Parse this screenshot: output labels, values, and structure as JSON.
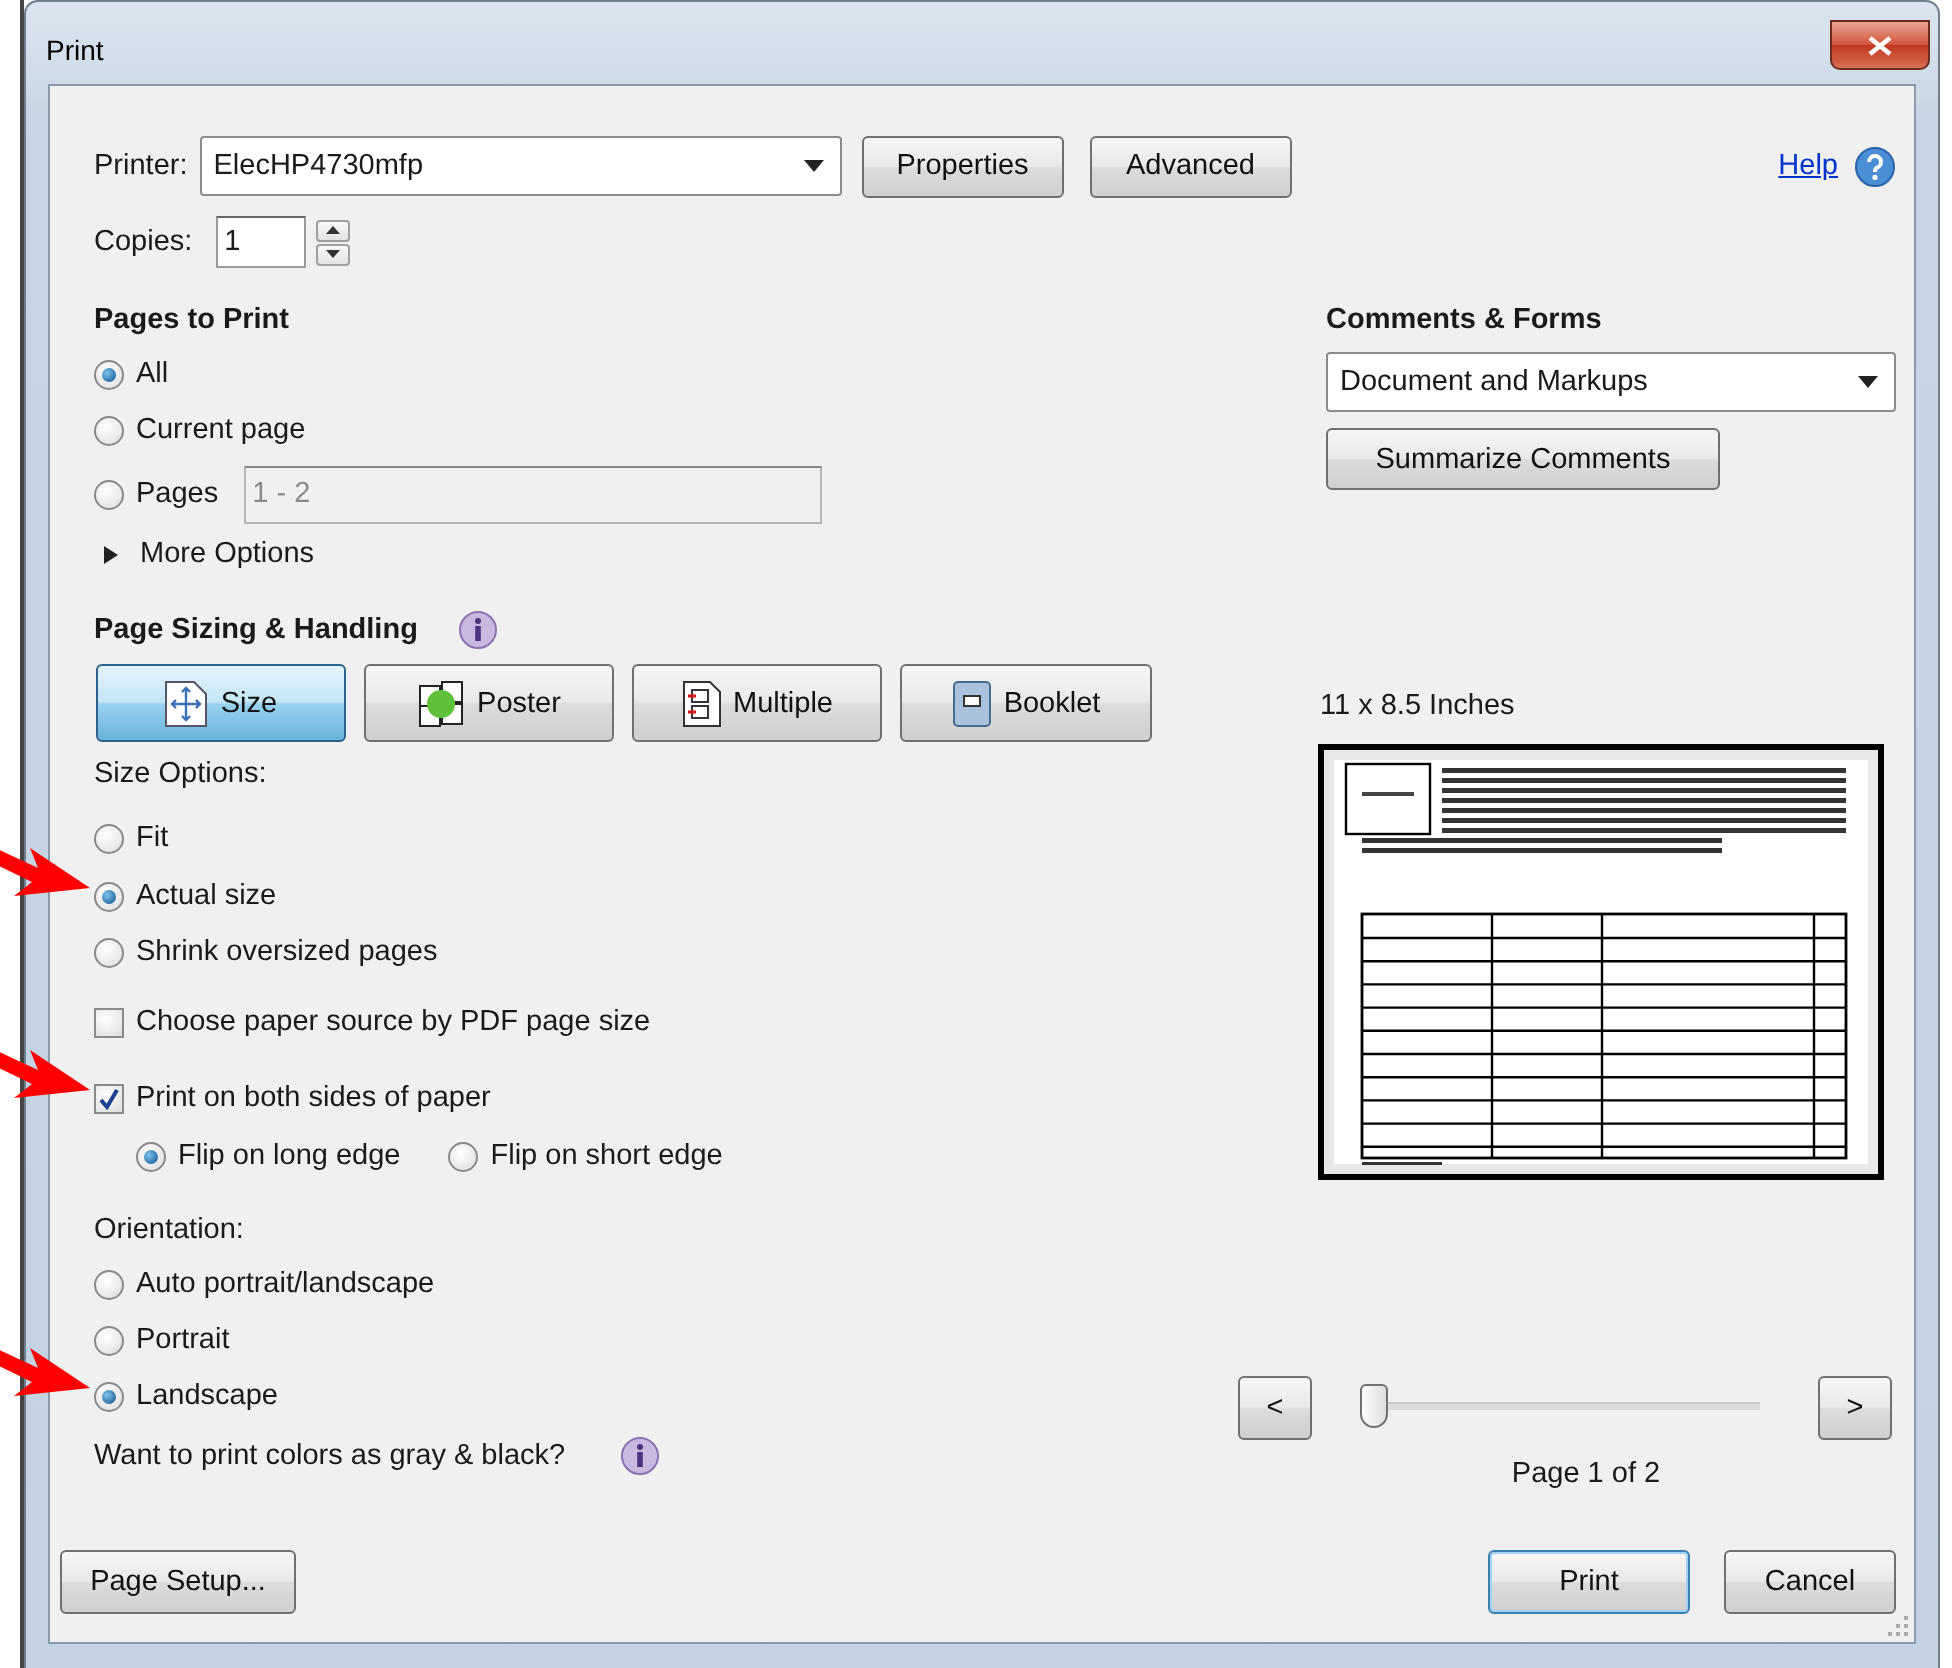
{
  "window": {
    "title": "Print"
  },
  "printer": {
    "label": "Printer:",
    "value": "ElecHP4730mfp"
  },
  "printer_buttons": [
    "Properties",
    "Advanced"
  ],
  "help": {
    "label": "Help"
  },
  "copies": {
    "label": "Copies:",
    "value": "1"
  },
  "pages_to_print": {
    "heading": "Pages to Print",
    "options": [
      {
        "label": "All",
        "selected": true
      },
      {
        "label": "Current page",
        "selected": false
      },
      {
        "label": "Pages",
        "selected": false,
        "range": {
          "value": "1 - 2",
          "disabled": true
        }
      }
    ],
    "more_options": {
      "label": "More Options",
      "expanded": false
    }
  },
  "page_sizing": {
    "heading": "Page Sizing & Handling",
    "modes": [
      {
        "kind": "size",
        "label": "Size",
        "selected": true
      },
      {
        "kind": "poster",
        "label": "Poster",
        "selected": false
      },
      {
        "kind": "multiple",
        "label": "Multiple",
        "selected": false
      },
      {
        "kind": "booklet",
        "label": "Booklet",
        "selected": false
      }
    ]
  },
  "size_options": {
    "heading": "Size Options:",
    "options": [
      {
        "label": "Fit",
        "selected": false,
        "highlighted": false
      },
      {
        "label": "Actual size",
        "selected": true,
        "highlighted": true
      },
      {
        "label": "Shrink oversized pages",
        "selected": false,
        "highlighted": false
      }
    ]
  },
  "checkboxes": [
    {
      "label": "Choose paper source by PDF page size",
      "checked": false,
      "highlighted": false
    },
    {
      "label": "Print on both sides of paper",
      "checked": true,
      "highlighted": true
    }
  ],
  "duplex": [
    {
      "label": "Flip on long edge",
      "selected": true
    },
    {
      "label": "Flip on short edge",
      "selected": false
    }
  ],
  "orientation": {
    "heading": "Orientation:",
    "options": [
      {
        "label": "Auto portrait/landscape",
        "selected": false,
        "highlighted": false
      },
      {
        "label": "Portrait",
        "selected": false,
        "highlighted": false
      },
      {
        "label": "Landscape",
        "selected": true,
        "highlighted": true
      }
    ]
  },
  "grayscale_question": "Want to print colors as gray & black?",
  "comments_forms": {
    "heading": "Comments & Forms",
    "value": "Document and Markups",
    "button": "Summarize Comments"
  },
  "preview": {
    "paper_size": "11 x 8.5 Inches",
    "prev": "<",
    "next": ">",
    "slider": {
      "level": 0
    },
    "page_label": "Page 1 of 2"
  },
  "buttons": [
    {
      "label": "Page Setup...",
      "default": false
    },
    {
      "label": "Print",
      "default": true
    },
    {
      "label": "Cancel",
      "default": false
    }
  ]
}
